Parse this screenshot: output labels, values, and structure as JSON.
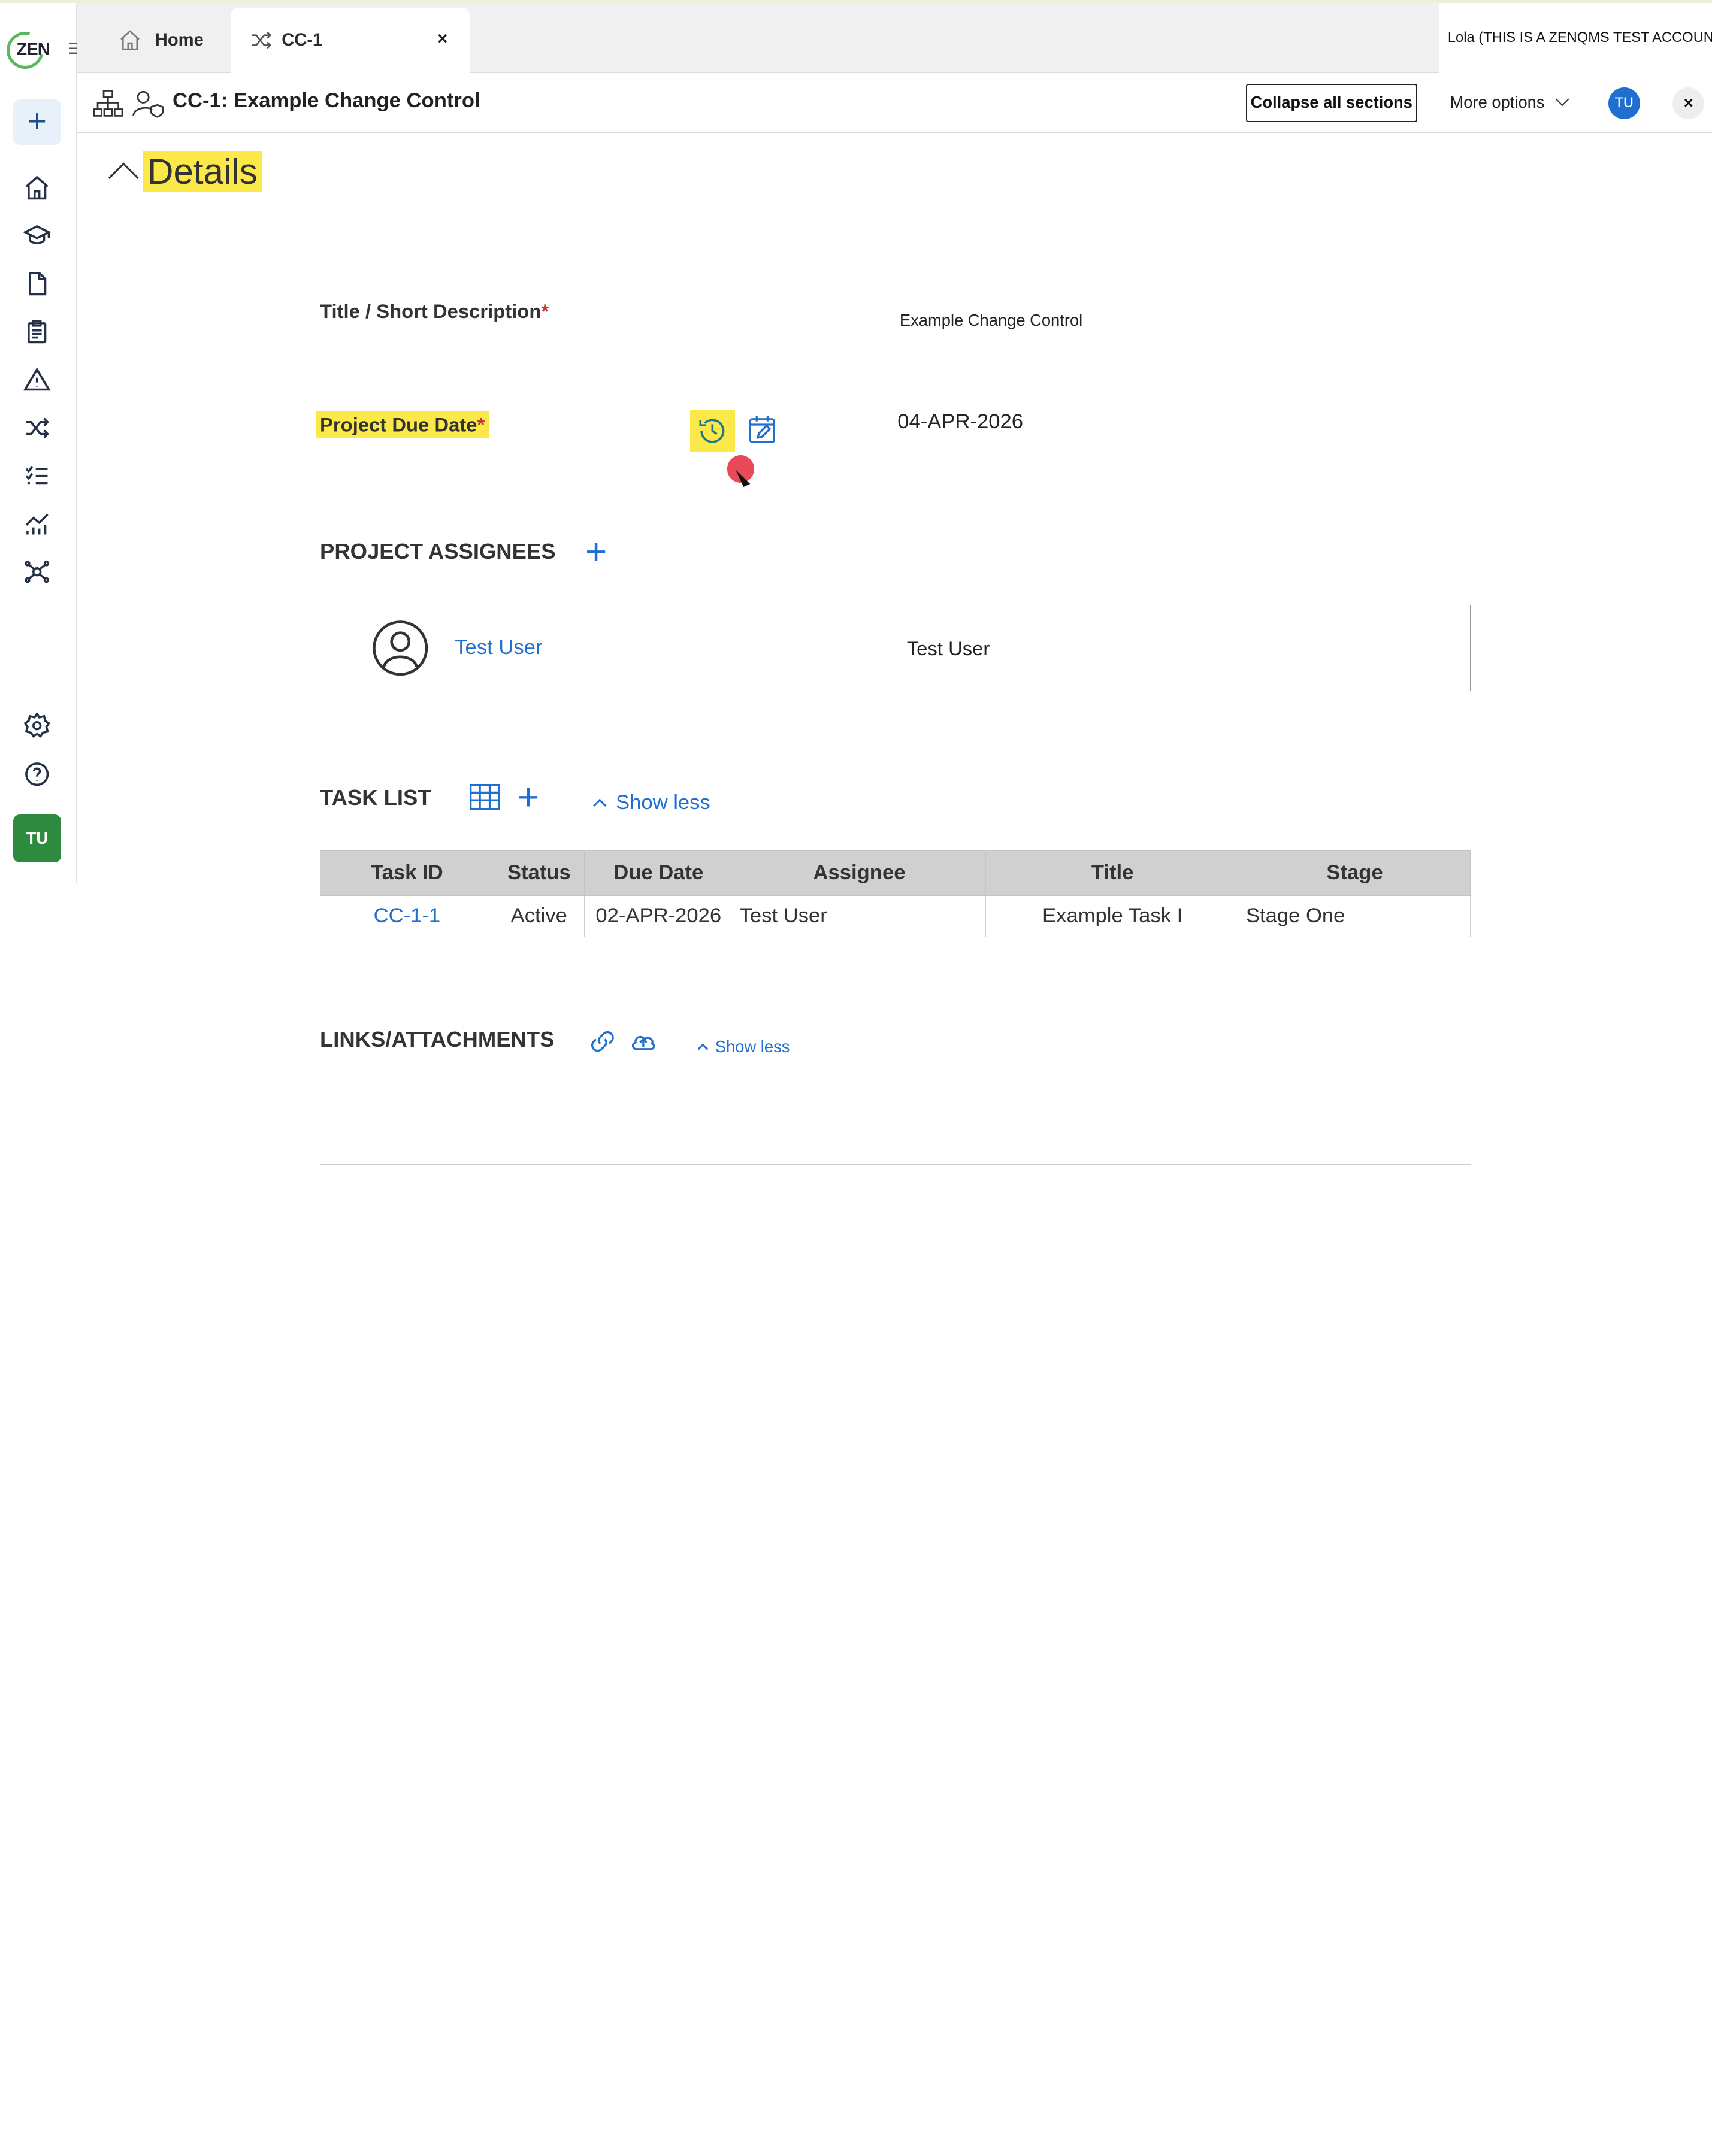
{
  "sidebar": {
    "logo_text": "ZEN",
    "new_button": "+",
    "user_initials": "TU"
  },
  "tabs": [
    {
      "label": "Home"
    },
    {
      "label": "CC-1",
      "close": "×"
    }
  ],
  "account": "Lola (THIS IS A ZENQMS TEST ACCOUNT",
  "header": {
    "title": "CC-1: Example Change Control",
    "collapse_label": "Collapse all sections",
    "more_options_label": "More options",
    "avatar_initials": "TU",
    "close": "×"
  },
  "details": {
    "section_title": "Details",
    "title_label": "Title / Short Description",
    "title_value": "Example Change Control",
    "due_date_label": "Project Due Date",
    "due_date_value": "04-APR-2026",
    "required_mark": "*"
  },
  "assignees": {
    "section_title": "PROJECT ASSIGNEES",
    "add": "+",
    "items": [
      {
        "name_link": "Test User",
        "name": "Test User"
      }
    ]
  },
  "task_list": {
    "section_title": "TASK LIST",
    "add": "+",
    "show_less": "Show less",
    "columns": [
      "Task ID",
      "Status",
      "Due Date",
      "Assignee",
      "Title",
      "Stage"
    ],
    "rows": [
      {
        "task_id": "CC-1-1",
        "status": "Active",
        "due_date": "02-APR-2026",
        "assignee": "Test User",
        "title": "Example Task I",
        "stage": "Stage One"
      }
    ]
  },
  "links": {
    "section_title": "LINKS/ATTACHMENTS",
    "show_less": "Show less"
  },
  "colors": {
    "accent": "#1f6fd1",
    "highlight": "#fbe94a",
    "avatar_green": "#2e8a3e"
  }
}
